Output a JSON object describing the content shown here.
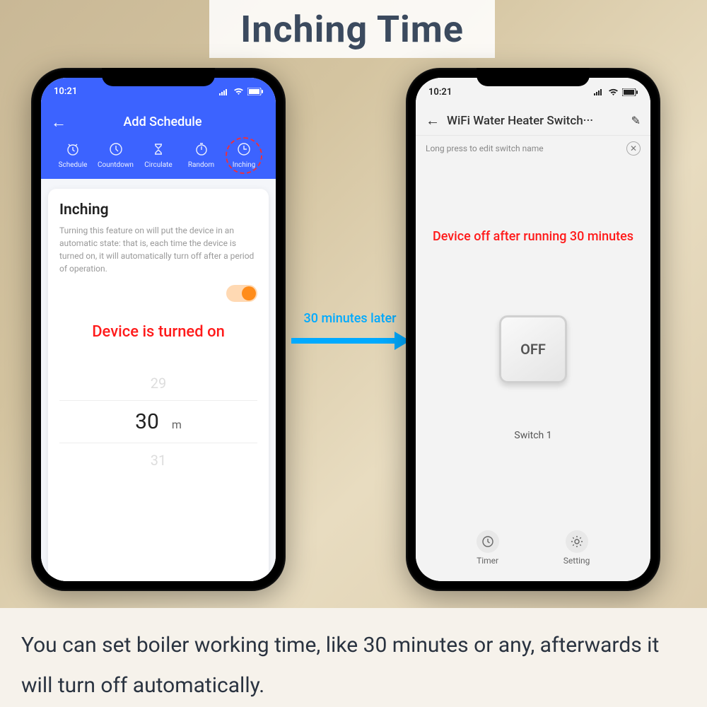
{
  "banner": {
    "title": "Inching Time"
  },
  "footer": {
    "text": "You can set boiler working time, like 30 minutes or any, afterwards it will turn off automatically."
  },
  "arrow": {
    "label": "30 minutes later"
  },
  "left": {
    "status_time": "10:21",
    "header_title": "Add Schedule",
    "tabs": [
      {
        "label": "Schedule"
      },
      {
        "label": "Countdown"
      },
      {
        "label": "Circulate"
      },
      {
        "label": "Random"
      },
      {
        "label": "Inching"
      }
    ],
    "card": {
      "title": "Inching",
      "description": "Turning this feature on will put the device in an automatic state: that is, each time the device is turned on, it will automatically turn off after a period of operation."
    },
    "annotation": "Device is turned on",
    "picker": {
      "prev": "29",
      "selected": "30",
      "unit": "m",
      "next": "31"
    }
  },
  "right": {
    "status_time": "10:21",
    "device_title": "WiFi Water Heater Switch···",
    "hint": "Long press to edit switch name",
    "annotation": "Device off after running 30 minutes",
    "button_label": "OFF",
    "switch_label": "Switch 1",
    "nav": {
      "timer": "Timer",
      "setting": "Setting"
    }
  }
}
